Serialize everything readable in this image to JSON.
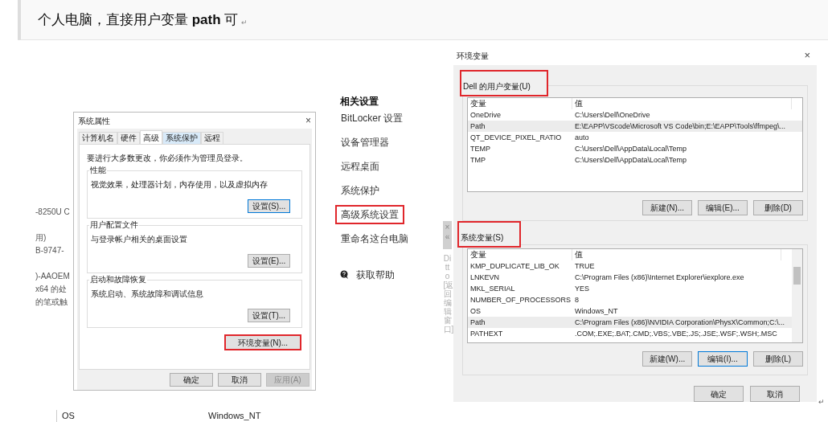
{
  "note": {
    "text": "个人电脑，直接用户变量 **path** 可",
    "paragraph_mark": "↵"
  },
  "left_fragments": [
    "-8250U C",
    "用)",
    "B-9747-",
    ")-AAOEM",
    "x64 的处",
    "的笔或触"
  ],
  "system_properties": {
    "title": "系统属性",
    "close": "×",
    "tabs": [
      {
        "label": "计算机名",
        "selected": false,
        "hovered": false
      },
      {
        "label": "硬件",
        "selected": false,
        "hovered": false
      },
      {
        "label": "高级",
        "selected": true,
        "hovered": false
      },
      {
        "label": "系统保护",
        "selected": false,
        "hovered": true
      },
      {
        "label": "远程",
        "selected": false,
        "hovered": false
      }
    ],
    "admin_note": "要进行大多数更改，你必须作为管理员登录。",
    "groups": [
      {
        "title": "性能",
        "description": "视觉效果，处理器计划，内存使用，以及虚拟内存",
        "button": {
          "label": "设置(S)...",
          "focused": true
        }
      },
      {
        "title": "用户配置文件",
        "description": "与登录帐户相关的桌面设置",
        "button": {
          "label": "设置(E)...",
          "focused": false
        }
      },
      {
        "title": "启动和故障恢复",
        "description": "系统启动、系统故障和调试信息",
        "button": {
          "label": "设置(T)...",
          "focused": false
        }
      }
    ],
    "env_button": {
      "label": "环境变量(N)...",
      "highlighted": true
    },
    "buttons": [
      {
        "label": "确定",
        "disabled": false
      },
      {
        "label": "取消",
        "disabled": false
      },
      {
        "label": "应用(A)",
        "disabled": true
      }
    ]
  },
  "related_settings": {
    "heading": "相关设置",
    "links": [
      {
        "label": "BitLocker 设置",
        "highlighted": false
      },
      {
        "label": "设备管理器",
        "highlighted": false
      },
      {
        "label": "远程桌面",
        "highlighted": false
      },
      {
        "label": "系统保护",
        "highlighted": false
      },
      {
        "label": "高级系统设置",
        "highlighted": true
      },
      {
        "label": "重命名这台电脑",
        "highlighted": false
      }
    ],
    "help": "获取帮助"
  },
  "ditto": {
    "close": "×",
    "collapse": "«",
    "label": "Ditto [返回编辑窗口]"
  },
  "env_dialog": {
    "title": "环境变量",
    "close": "×",
    "sections": [
      {
        "title": "Dell 的用户变量(U)",
        "highlighted": true,
        "scrollbar": false,
        "columns": [
          "变量",
          "值"
        ],
        "rows": [
          {
            "name": "OneDrive",
            "value": "C:\\Users\\Dell\\OneDrive",
            "selected": false
          },
          {
            "name": "Path",
            "value": "E:\\EAPP\\VScode\\Microsoft VS Code\\bin;E:\\EAPP\\Tools\\ffmpeg\\...",
            "selected": true
          },
          {
            "name": "QT_DEVICE_PIXEL_RATIO",
            "value": "auto",
            "selected": false
          },
          {
            "name": "TEMP",
            "value": "C:\\Users\\Dell\\AppData\\Local\\Temp",
            "selected": false
          },
          {
            "name": "TMP",
            "value": "C:\\Users\\Dell\\AppData\\Local\\Temp",
            "selected": false
          }
        ],
        "buttons": [
          {
            "label": "新建(N)...",
            "focused": false
          },
          {
            "label": "编辑(E)...",
            "focused": false
          },
          {
            "label": "删除(D)",
            "focused": false
          }
        ]
      },
      {
        "title": "系统变量(S)",
        "highlighted": true,
        "scrollbar": true,
        "columns": [
          "变量",
          "值"
        ],
        "rows": [
          {
            "name": "KMP_DUPLICATE_LIB_OK",
            "value": "TRUE",
            "selected": false
          },
          {
            "name": "LNKEVN",
            "value": "C:\\Program Files (x86)\\Internet Explorer\\iexplore.exe",
            "selected": false
          },
          {
            "name": "MKL_SERIAL",
            "value": "YES",
            "selected": false
          },
          {
            "name": "NUMBER_OF_PROCESSORS",
            "value": "8",
            "selected": false
          },
          {
            "name": "OS",
            "value": "Windows_NT",
            "selected": false
          },
          {
            "name": "Path",
            "value": "C:\\Program Files (x86)\\NVIDIA Corporation\\PhysX\\Common;C:\\...",
            "selected": true
          },
          {
            "name": "PATHEXT",
            "value": ".COM;.EXE;.BAT;.CMD;.VBS;.VBE;.JS;.JSE;.WSF;.WSH;.MSC",
            "selected": false
          }
        ],
        "buttons": [
          {
            "label": "新建(W)...",
            "focused": false
          },
          {
            "label": "编辑(I)...",
            "focused": true
          },
          {
            "label": "删除(L)",
            "focused": false
          }
        ]
      }
    ],
    "buttons": [
      {
        "label": "确定"
      },
      {
        "label": "取消"
      }
    ],
    "paragraph_mark": "↵"
  },
  "bottom_row": [
    "OS",
    "Windows_NT"
  ]
}
